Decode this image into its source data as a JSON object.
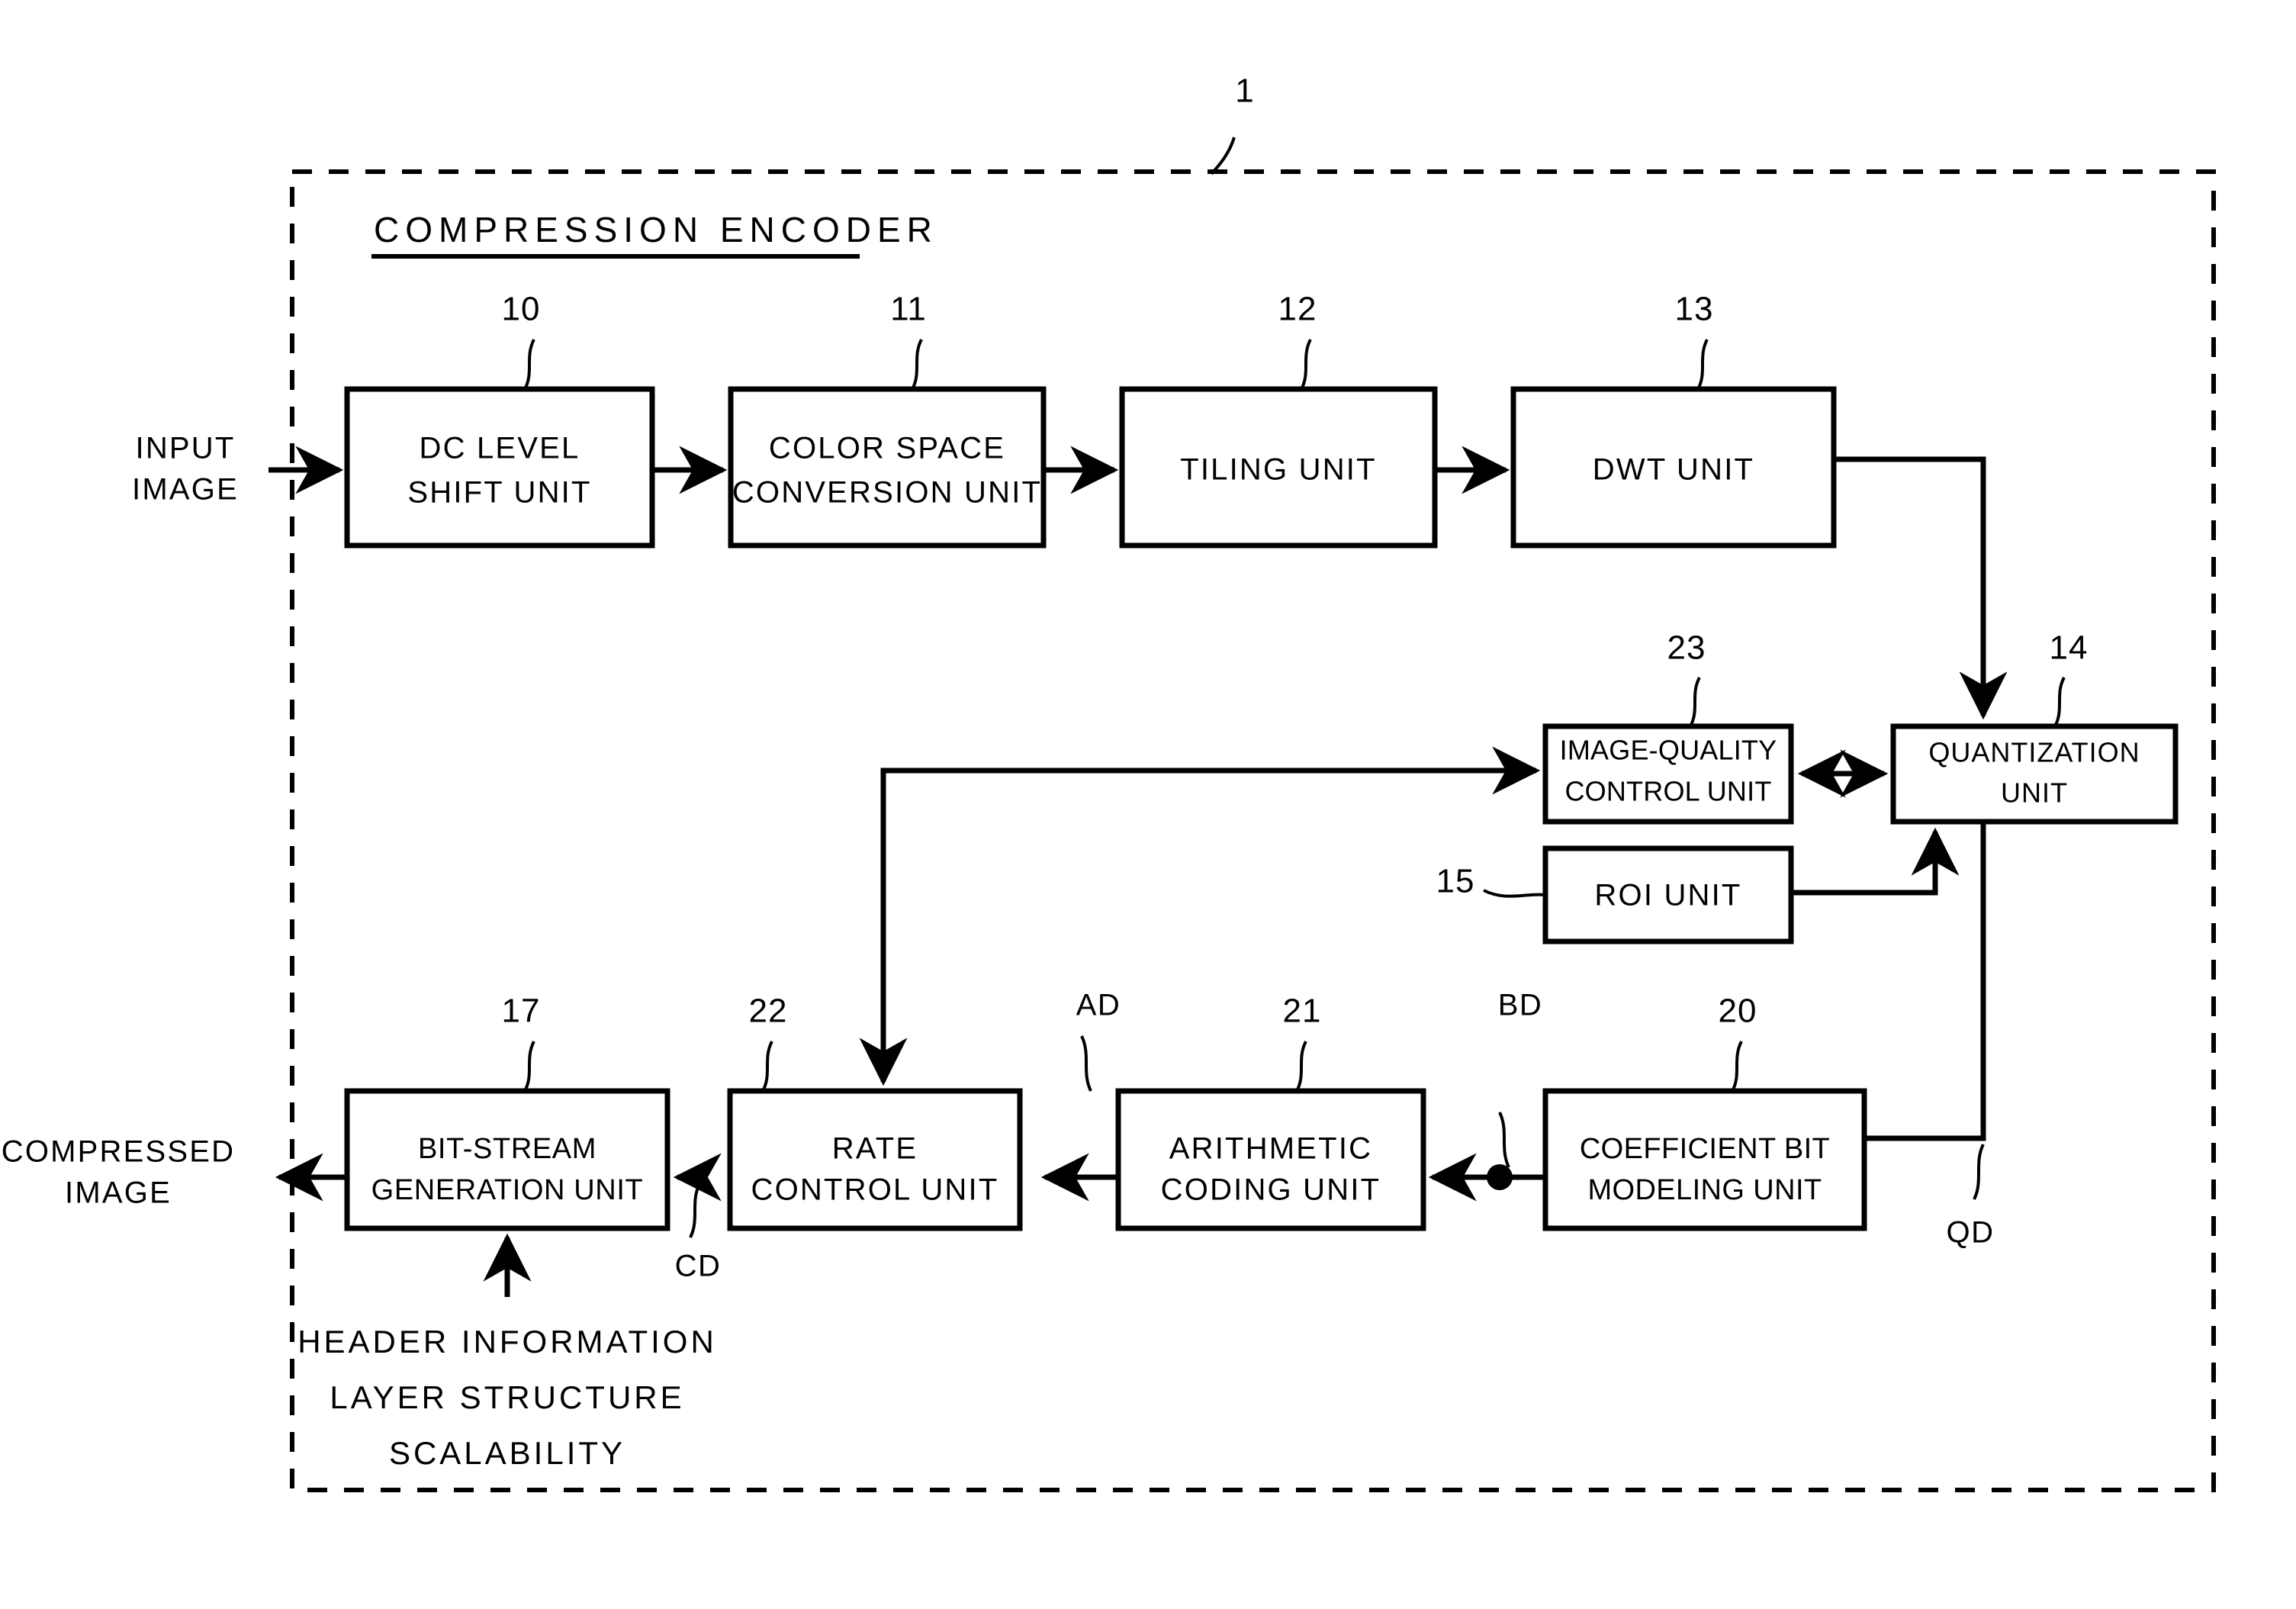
{
  "figure": {
    "outer_ref": "1",
    "container_title": "COMPRESSION ENCODER"
  },
  "io_labels": {
    "input_line1": "INPUT",
    "input_line2": "IMAGE",
    "output_line1": "COMPRESSED",
    "output_line2": "IMAGE"
  },
  "blocks": [
    {
      "ref": "10",
      "line1": "DC LEVEL",
      "line2": "SHIFT UNIT"
    },
    {
      "ref": "11",
      "line1": "COLOR SPACE",
      "line2": "CONVERSION UNIT"
    },
    {
      "ref": "12",
      "line1": "TILING UNIT",
      "line2": ""
    },
    {
      "ref": "13",
      "line1": "DWT UNIT",
      "line2": ""
    },
    {
      "ref": "23",
      "line1": "IMAGE-QUALITY",
      "line2": "CONTROL UNIT"
    },
    {
      "ref": "14",
      "line1": "QUANTIZATION",
      "line2": "UNIT"
    },
    {
      "ref": "15",
      "line1": "ROI UNIT",
      "line2": ""
    },
    {
      "ref": "17",
      "line1": "BIT-STREAM",
      "line2": "GENERATION UNIT"
    },
    {
      "ref": "22",
      "line1": "RATE",
      "line2": "CONTROL UNIT"
    },
    {
      "ref": "21",
      "line1": "ARITHMETIC",
      "line2": "CODING UNIT"
    },
    {
      "ref": "20",
      "line1": "COEFFICIENT BIT",
      "line2": "MODELING UNIT"
    }
  ],
  "signals": {
    "ad": "AD",
    "bd": "BD",
    "cd": "CD",
    "qd": "QD"
  },
  "footnote": {
    "line1": "HEADER INFORMATION",
    "line2": "LAYER STRUCTURE",
    "line3": "SCALABILITY"
  },
  "colors": {
    "ink": "#000000",
    "paper": "#ffffff"
  }
}
